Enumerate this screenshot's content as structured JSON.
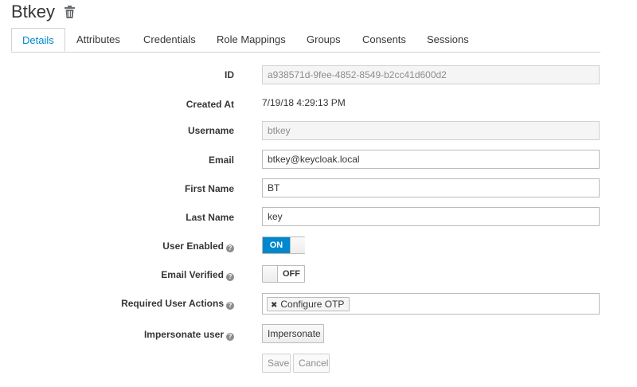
{
  "page": {
    "title": "Btkey"
  },
  "tabs": [
    {
      "label": "Details",
      "active": true
    },
    {
      "label": "Attributes"
    },
    {
      "label": "Credentials"
    },
    {
      "label": "Role Mappings"
    },
    {
      "label": "Groups"
    },
    {
      "label": "Consents"
    },
    {
      "label": "Sessions"
    }
  ],
  "form": {
    "id": {
      "label": "ID",
      "value": "a938571d-9fee-4852-8549-b2cc41d600d2"
    },
    "created_at": {
      "label": "Created At",
      "value": "7/19/18 4:29:13 PM"
    },
    "username": {
      "label": "Username",
      "value": "btkey"
    },
    "email": {
      "label": "Email",
      "value": "btkey@keycloak.local"
    },
    "first_name": {
      "label": "First Name",
      "value": "BT"
    },
    "last_name": {
      "label": "Last Name",
      "value": "key"
    },
    "user_enabled": {
      "label": "User Enabled",
      "state": "ON"
    },
    "email_verified": {
      "label": "Email Verified",
      "state": "OFF"
    },
    "required_actions": {
      "label": "Required User Actions",
      "tags": [
        "Configure OTP"
      ]
    },
    "impersonate": {
      "label": "Impersonate user",
      "button": "Impersonate"
    }
  },
  "actions": {
    "save": "Save",
    "cancel": "Cancel"
  },
  "colors": {
    "accent": "#0088ce",
    "text": "#363636",
    "muted": "#8b8d8f",
    "border": "#bbbbbb"
  },
  "icons": {
    "delete": "trash-icon",
    "help": "question-circle-icon",
    "remove_tag": "close-icon"
  }
}
